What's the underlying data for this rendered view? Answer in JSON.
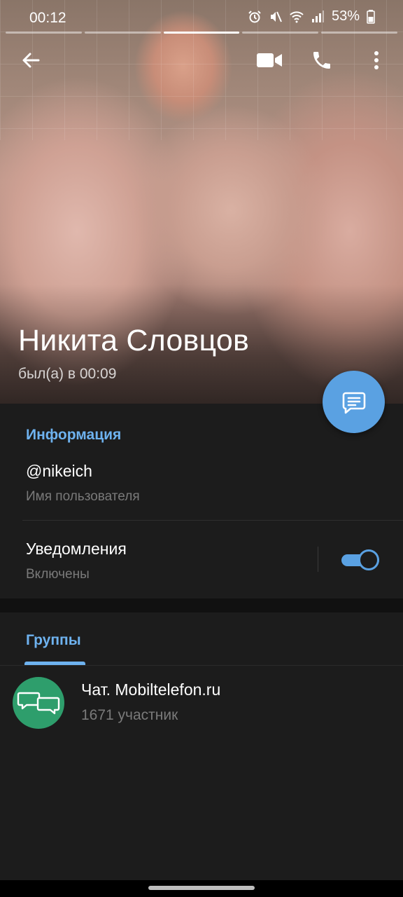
{
  "status_bar": {
    "time": "00:12",
    "battery": "53%"
  },
  "story": {
    "segments": 5,
    "active_index": 2
  },
  "profile": {
    "name": "Никита Словцов",
    "last_seen": "был(а) в 00:09"
  },
  "info": {
    "section_title": "Информация",
    "username": "@nikeich",
    "username_label": "Имя пользователя",
    "notifications_label": "Уведомления",
    "notifications_state": "Включены",
    "notifications_enabled": true
  },
  "groups": {
    "tab_label": "Группы",
    "items": [
      {
        "name": "Чат. Mobiltelefon.ru",
        "members": "1671 участник"
      }
    ]
  },
  "colors": {
    "accent": "#5aa1e2",
    "section_title": "#6eb2ef",
    "group_avatar": "#2e9e6c",
    "background": "#1c1c1c"
  }
}
